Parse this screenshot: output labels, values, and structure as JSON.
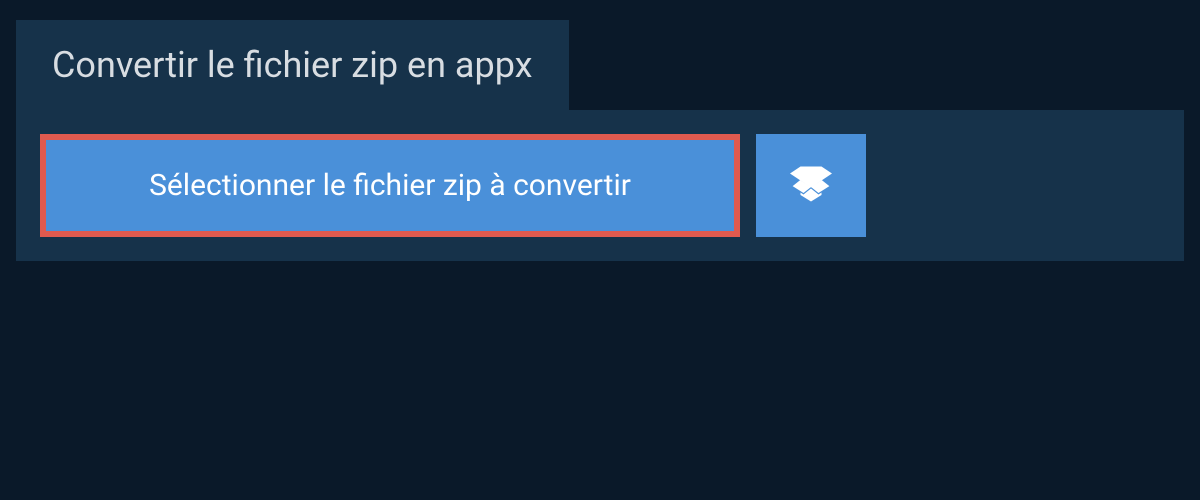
{
  "header": {
    "title": "Convertir le fichier zip en appx"
  },
  "actions": {
    "select_label": "Sélectionner le fichier zip à convertir",
    "dropbox_icon_name": "dropbox-icon"
  },
  "colors": {
    "page_bg": "#0a1929",
    "panel_bg": "#16324a",
    "button_bg": "#4a90d9",
    "highlight_border": "#e05a4f",
    "text_light": "#d8dde2",
    "text_white": "#ffffff"
  }
}
